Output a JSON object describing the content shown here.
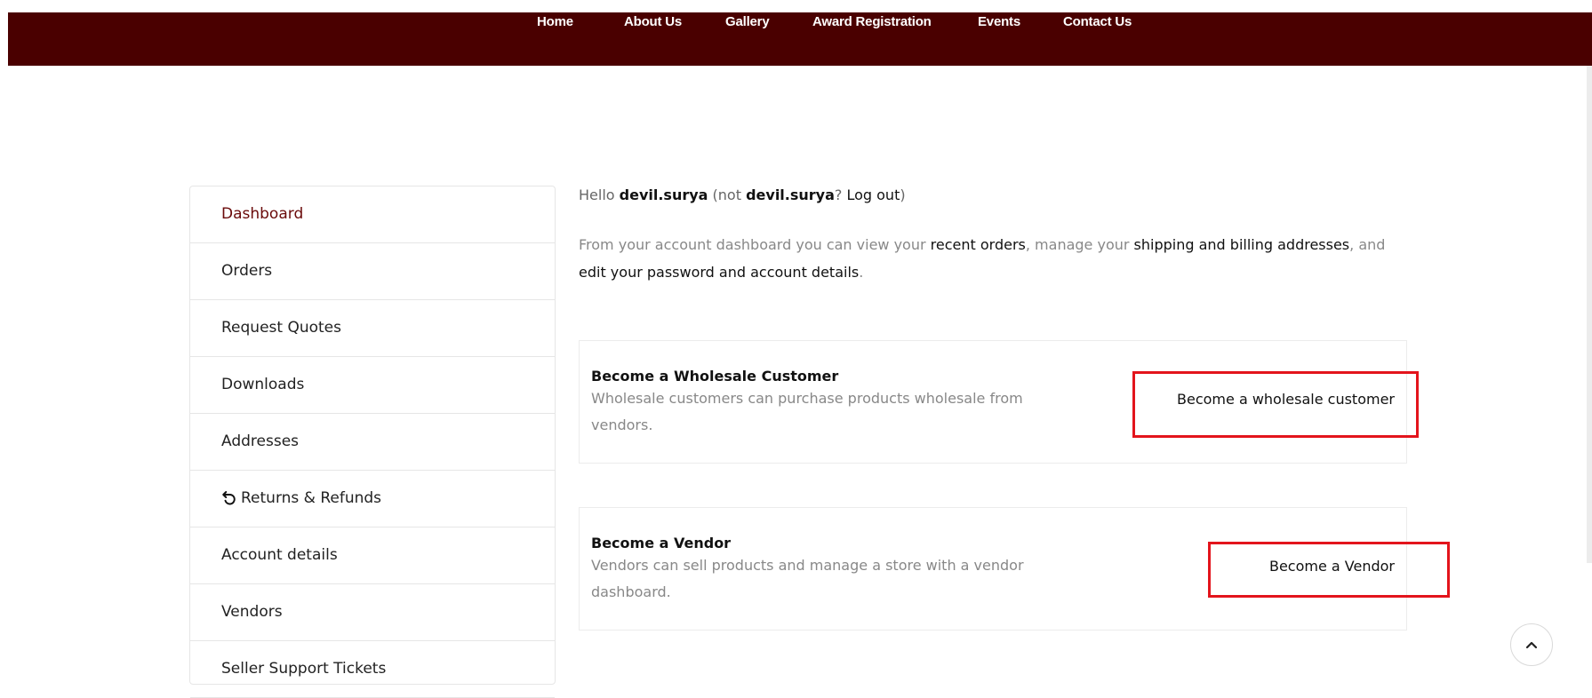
{
  "nav": {
    "items": [
      "Home",
      "About Us",
      "Gallery",
      "Award Registration",
      "Events",
      "Contact Us"
    ]
  },
  "sidebar": {
    "items": [
      {
        "label": "Dashboard",
        "active": true
      },
      {
        "label": "Orders"
      },
      {
        "label": "Request Quotes"
      },
      {
        "label": "Downloads"
      },
      {
        "label": "Addresses"
      },
      {
        "label": "Returns & Refunds",
        "icon": "undo-icon"
      },
      {
        "label": "Account details"
      },
      {
        "label": "Vendors"
      },
      {
        "label": "Seller Support Tickets"
      }
    ]
  },
  "greeting": {
    "prefix": "Hello ",
    "username": "devil.surya",
    "not_text": " (not ",
    "username2": "devil.surya",
    "question": "? ",
    "logout": "Log out",
    "close": ")"
  },
  "intro": {
    "t1": "From your account dashboard you can view your ",
    "recent_orders": "recent orders",
    "t2": ", manage your ",
    "addresses": "shipping and billing addresses",
    "t3": ", and ",
    "edit": "edit your password and account details",
    "t4": "."
  },
  "wholesale": {
    "title": "Become a Wholesale Customer",
    "description": "Wholesale customers can purchase products wholesale from vendors.",
    "button": "Become a wholesale customer"
  },
  "vendor": {
    "title": "Become a Vendor",
    "description": "Vendors can sell products and manage a store with a vendor dashboard.",
    "button": "Become a Vendor"
  },
  "colors": {
    "topbar": "#4a0000",
    "active_link": "#6a0a0a",
    "highlight": "#e3141c"
  }
}
